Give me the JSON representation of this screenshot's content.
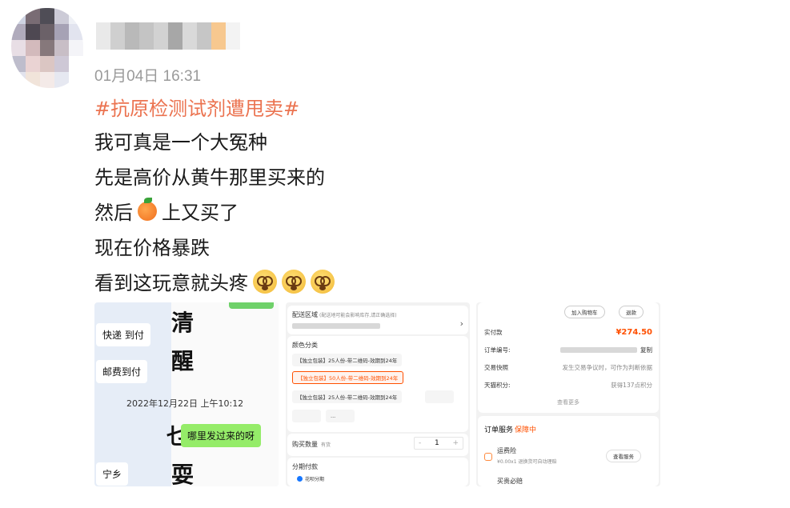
{
  "post": {
    "time": "01月04日 16:31",
    "hashtag": "#抗原检测试剂遭甩卖#",
    "lines": [
      "我可真是一个大冤种",
      "先是高价从黄牛那里买来的",
      "然后",
      "上又买了",
      "现在价格暴跌",
      "看到这玩意就头疼"
    ]
  },
  "icons": {
    "peach": "peach-emoji-icon",
    "dizzy": "dizzy-face-emoji-icon"
  },
  "colors": {
    "hashtag": "#eb7350",
    "accent": "#ff5000",
    "chat_green": "#95ec69"
  },
  "thumb_chat": {
    "bubble_1": "快递 到付",
    "bubble_2": "邮费到付",
    "time": "2022年12月22日 上午10:12",
    "bubble_green": "哪里发过来的呀",
    "bubble_3": "宁乡",
    "calli": [
      "清",
      "醒",
      "乜",
      "耍"
    ]
  },
  "thumb_product": {
    "delivery_title": "配送区域",
    "delivery_hint": "(配送地可能会影响库存,请正确选择)",
    "color_title": "颜色分类",
    "opt_1": "【独立包装】25人份-带二维码-效期到24年",
    "opt_2": "【独立包装】50人份-带二维码-效期到24年",
    "opt_3": "【独立包装】25人份-带二维码-效期到24年",
    "opt_4": "...",
    "qty_label": "购买数量",
    "qty_stock": "有货",
    "qty_minus": "-",
    "qty_value": "1",
    "qty_plus": "+",
    "installment_label": "分期付款",
    "installment_option": "花呗分期"
  },
  "thumb_order": {
    "btn_cart": "加入购物车",
    "btn_refund": "退款",
    "paid_label": "实付款",
    "paid_value": "¥274.50",
    "order_no_label": "订单编号:",
    "order_no_copy": "复制",
    "snapshot_label": "交易快照",
    "snapshot_value": "发生交易争议时，可作为判断依据",
    "points_label": "天猫积分:",
    "points_value": "获得137点积分",
    "more": "查看更多",
    "service_title": "订单服务",
    "service_tag": "保障中",
    "insurance_title": "运费险",
    "insurance_desc": "¥0.00x1 退换货可自动理赔",
    "view_service": "查看服务",
    "must_return": "买贵必赔"
  }
}
